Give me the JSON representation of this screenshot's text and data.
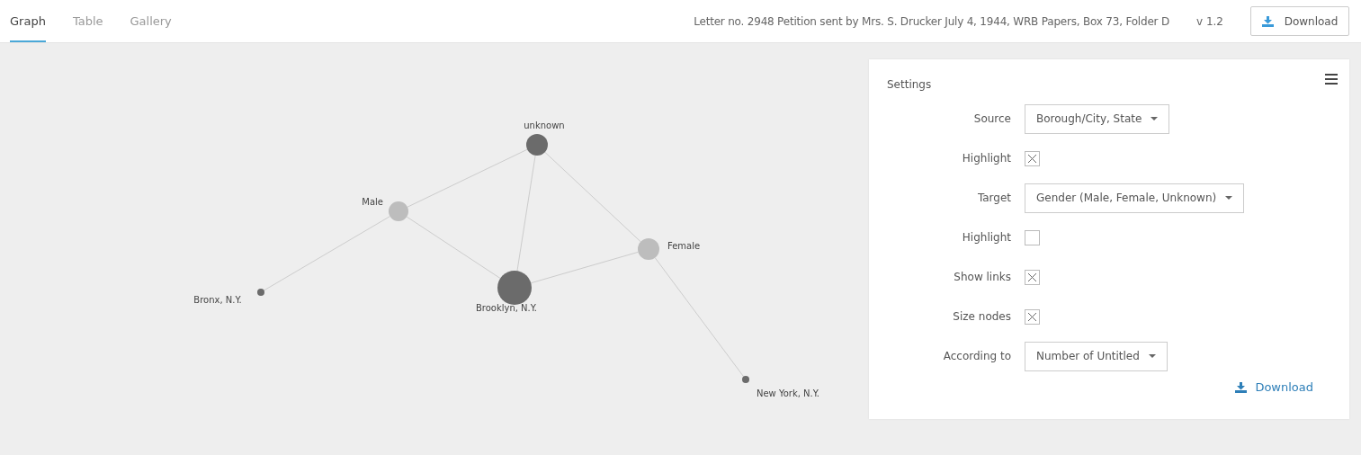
{
  "tabs": [
    {
      "label": "Graph",
      "selected": true
    },
    {
      "label": "Table",
      "selected": false
    },
    {
      "label": "Gallery",
      "selected": false
    }
  ],
  "header": {
    "title": "Letter no. 2948 Petition sent by Mrs. S. Drucker July 4, 1944, WRB Papers, Box 73, Folder D",
    "version": "v 1.2",
    "download": "Download"
  },
  "graph": {
    "nodes": [
      {
        "label": "unknown",
        "color": "#6b6b6b"
      },
      {
        "label": "Male",
        "color": "#bdbdbd"
      },
      {
        "label": "Female",
        "color": "#bdbdbd"
      },
      {
        "label": "Brooklyn, N.Y.",
        "color": "#6b6b6b"
      },
      {
        "label": "Bronx, N.Y.",
        "color": "#6b6b6b"
      },
      {
        "label": "New York, N.Y.",
        "color": "#6b6b6b"
      }
    ]
  },
  "settings": {
    "title": "Settings",
    "rows": [
      {
        "kind": "select",
        "label": "Source",
        "value": "Borough/City, State"
      },
      {
        "kind": "checkbox",
        "label": "Highlight",
        "checked": true
      },
      {
        "kind": "select",
        "label": "Target",
        "value": "Gender (Male, Female, Unknown)"
      },
      {
        "kind": "checkbox",
        "label": "Highlight",
        "checked": false
      },
      {
        "kind": "checkbox",
        "label": "Show links",
        "checked": true
      },
      {
        "kind": "checkbox",
        "label": "Size nodes",
        "checked": true
      },
      {
        "kind": "select",
        "label": "According to",
        "value": "Number of Untitled"
      }
    ],
    "download": "Download"
  }
}
